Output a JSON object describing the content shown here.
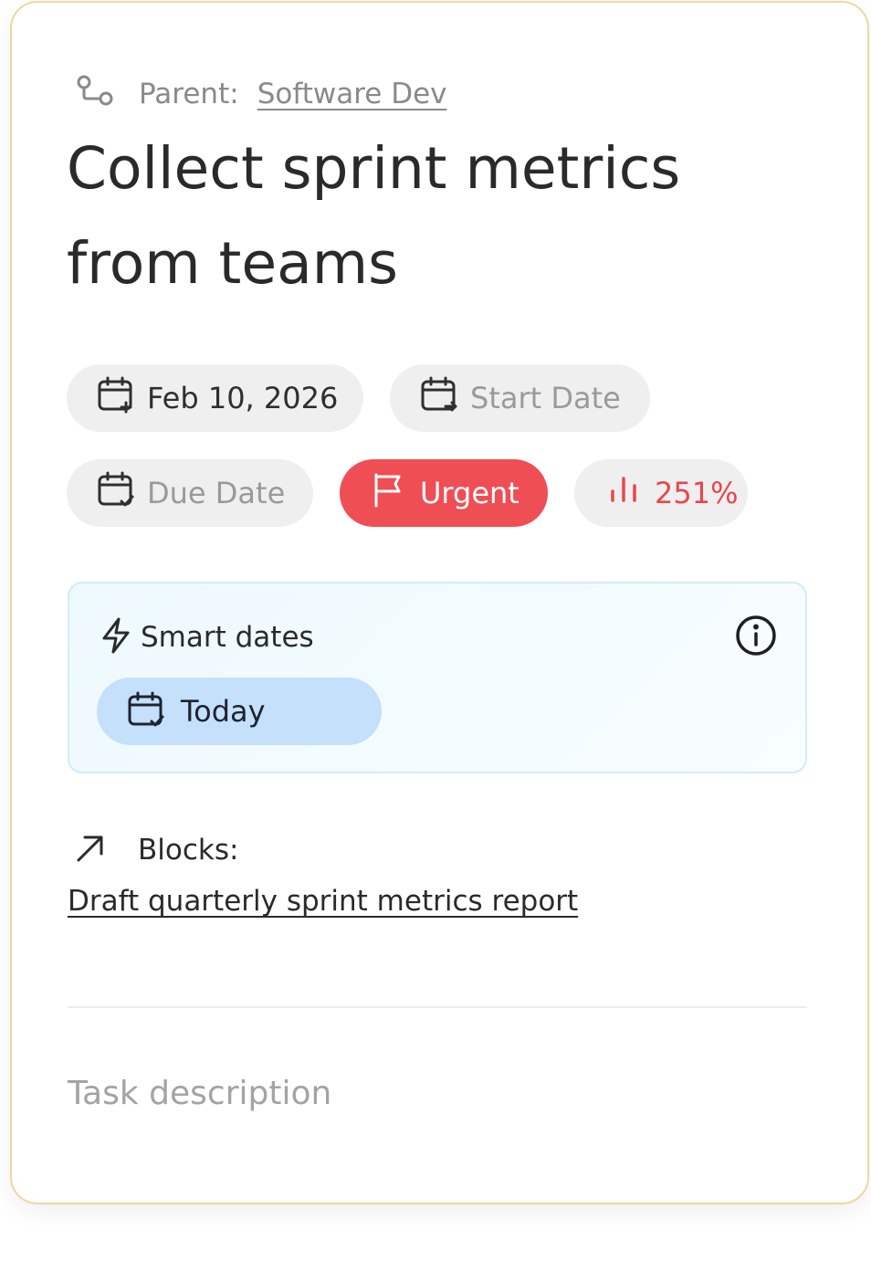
{
  "task": {
    "parent_label": "Parent:",
    "parent_name": "Software Dev",
    "title": "Collect sprint metrics from teams"
  },
  "chips": {
    "created_date": "Feb 10, 2026",
    "start_date": "Start Date",
    "due_date": "Due Date",
    "priority": "Urgent",
    "progress": "251%"
  },
  "smart_dates": {
    "title": "Smart dates",
    "suggestion": "Today"
  },
  "blocks": {
    "label": "Blocks:",
    "task": "Draft quarterly sprint metrics report"
  },
  "description": {
    "placeholder": "Task description"
  },
  "colors": {
    "card_border": "#ecd9a0",
    "urgent": "#ef4e54",
    "progress": "#e8464d",
    "smart_bg": "#eef9fe",
    "today_chip": "#c4e0fb"
  }
}
